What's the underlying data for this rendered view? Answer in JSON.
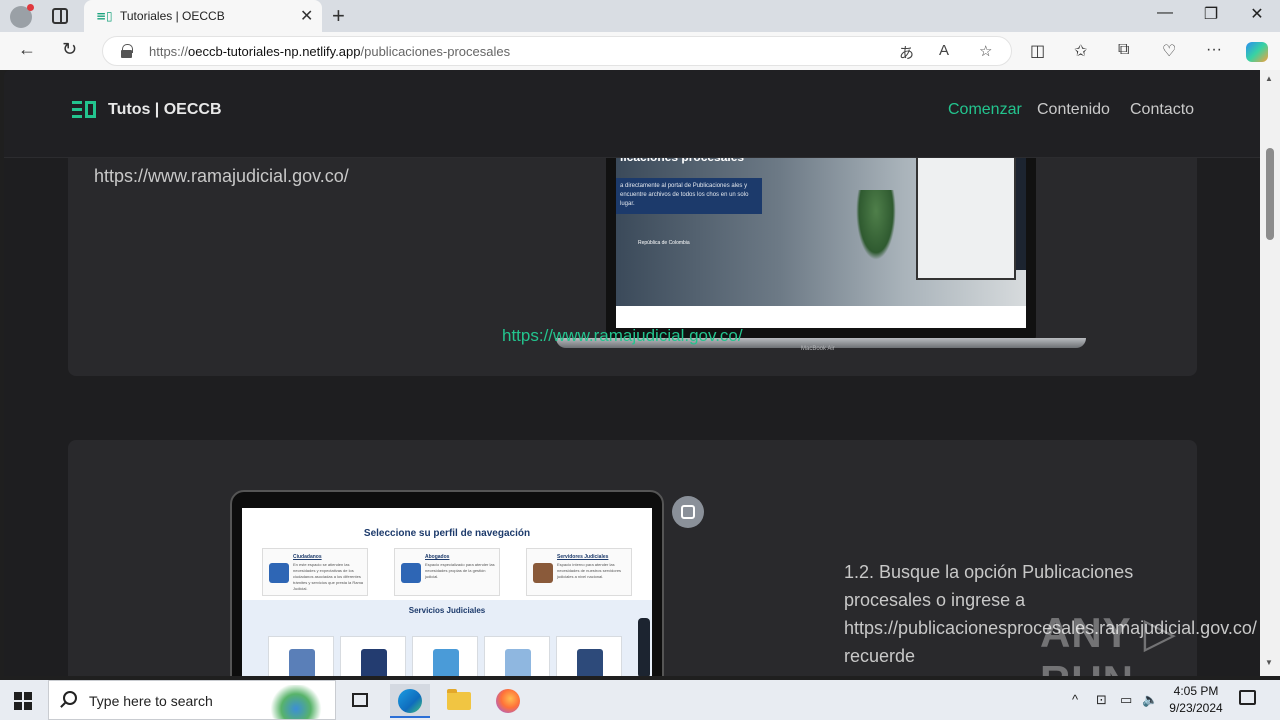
{
  "browser": {
    "tab_title": "Tutoriales | OECCB",
    "tab_favicon": "≡▯",
    "url_scheme": "https://",
    "url_host": "oeccb-tutoriales-np.netlify.app",
    "url_path": "/publicaciones-procesales",
    "icons": [
      "back-icon",
      "refresh-icon",
      "lock-icon",
      "translate-icon",
      "read-aloud-icon",
      "favorite-star-icon",
      "split-screen-icon",
      "favorites-icon",
      "collections-icon",
      "browser-essentials-icon",
      "more-icon",
      "copilot-icon"
    ]
  },
  "site": {
    "logo_text": "Tutos | OECCB",
    "nav": {
      "comenzar": "Comenzar",
      "contenido": "Contenido",
      "contacto": "Contacto"
    },
    "accent_color": "#23c48e"
  },
  "section1": {
    "url_text": "https://www.ramajudicial.gov.co/",
    "link_text": "https://www.ramajudicial.gov.co/",
    "screenshot": {
      "title": "licaciones procesales",
      "box_text": "a directamente al portal de Publicaciones ales y encuentre archivos de todos los chos en un solo lugar.",
      "sub": "República de Colombia",
      "brand": "MacBook Air"
    }
  },
  "section2": {
    "screenshot": {
      "title": "Seleccione su perfil de navegación",
      "cards": [
        {
          "title": "Ciudadanos",
          "text": "En este espacio se atienden las necesidades y expectativas de los ciudadanos asociadas a los diferentes trámites y servicios que presta la Rama Judicial."
        },
        {
          "title": "Abogados",
          "text": "Espacio especializado para atender las necesidades propias de la gestión judicial."
        },
        {
          "title": "Servidores Judiciales",
          "text": "Espacio interno para atender las necesidades de nuestros servidores judiciales a nivel nacional."
        }
      ],
      "servicios_title": "Servicios Judiciales"
    },
    "step_text": "1.2. Busque la opción Publicaciones procesales o ingrese a https://publicacionesprocesales.ramajudicial.gov.co/ recuerde"
  },
  "watermark": "ANY ▷ RUN",
  "taskbar": {
    "search_placeholder": "Type here to search",
    "time": "4:05 PM",
    "date": "9/23/2024"
  }
}
